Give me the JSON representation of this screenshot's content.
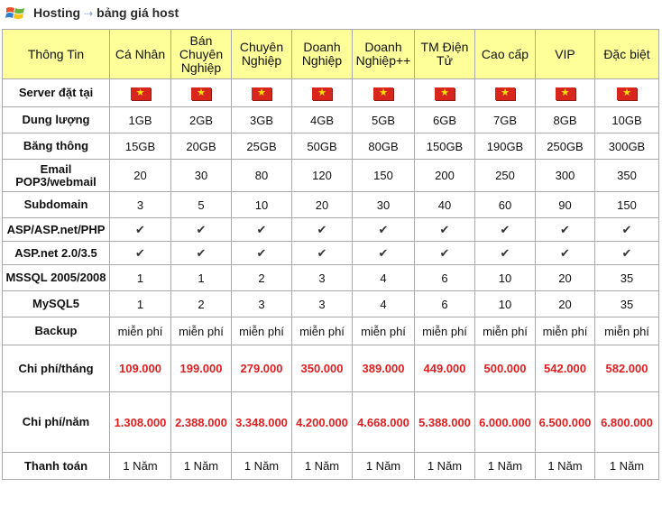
{
  "breadcrumb": {
    "root": "Hosting",
    "separator": "⇢",
    "current": "bảng giá host"
  },
  "colors": {
    "header_bg": "#ffff99",
    "price_red": "#e02020",
    "border": "#aaaaaa"
  },
  "table": {
    "corner_label": "Thông Tin",
    "plans": [
      "Cá Nhân",
      "Bán Chuyên Nghiệp",
      "Chuyên Nghiệp",
      "Doanh Nghiệp",
      "Doanh Nghiệp++",
      "TM Điện Tử",
      "Cao cấp",
      "VIP",
      "Đặc biệt"
    ],
    "rows": [
      {
        "label": "Server đặt tại",
        "type": "flag",
        "cells": [
          "vn-flag",
          "vn-flag",
          "vn-flag",
          "vn-flag",
          "vn-flag",
          "vn-flag",
          "vn-flag",
          "vn-flag",
          "vn-flag"
        ]
      },
      {
        "label": "Dung lượng",
        "type": "text",
        "cells": [
          "1GB",
          "2GB",
          "3GB",
          "4GB",
          "5GB",
          "6GB",
          "7GB",
          "8GB",
          "10GB"
        ]
      },
      {
        "label": "Băng thông",
        "type": "text",
        "cells": [
          "15GB",
          "20GB",
          "25GB",
          "50GB",
          "80GB",
          "150GB",
          "190GB",
          "250GB",
          "300GB"
        ]
      },
      {
        "label": "Email POP3/webmail",
        "type": "text",
        "cells": [
          "20",
          "30",
          "80",
          "120",
          "150",
          "200",
          "250",
          "300",
          "350"
        ]
      },
      {
        "label": "Subdomain",
        "type": "text",
        "cells": [
          "3",
          "5",
          "10",
          "20",
          "30",
          "40",
          "60",
          "90",
          "150"
        ]
      },
      {
        "label": "ASP/ASP.net/PHP",
        "type": "check",
        "cells": [
          "✔",
          "✔",
          "✔",
          "✔",
          "✔",
          "✔",
          "✔",
          "✔",
          "✔"
        ]
      },
      {
        "label": "ASP.net 2.0/3.5",
        "type": "check",
        "cells": [
          "✔",
          "✔",
          "✔",
          "✔",
          "✔",
          "✔",
          "✔",
          "✔",
          "✔"
        ]
      },
      {
        "label": "MSSQL 2005/2008",
        "type": "text",
        "cells": [
          "1",
          "1",
          "2",
          "3",
          "4",
          "6",
          "10",
          "20",
          "35"
        ]
      },
      {
        "label": "MySQL5",
        "type": "text",
        "cells": [
          "1",
          "2",
          "3",
          "3",
          "4",
          "6",
          "10",
          "20",
          "35"
        ]
      },
      {
        "label": "Backup",
        "type": "text",
        "cells": [
          "miễn phí",
          "miễn phí",
          "miễn phí",
          "miễn phí",
          "miễn phí",
          "miễn phí",
          "miễn phí",
          "miễn phí",
          "miễn phí"
        ]
      },
      {
        "label": "Chi phí/tháng",
        "type": "price",
        "cells": [
          "109.000",
          "199.000",
          "279.000",
          "350.000",
          "389.000",
          "449.000",
          "500.000",
          "542.000",
          "582.000"
        ]
      },
      {
        "label": "Chi phí/năm",
        "type": "price",
        "cells": [
          "1.308.000",
          "2.388.000",
          "3.348.000",
          "4.200.000",
          "4.668.000",
          "5.388.000",
          "6.000.000",
          "6.500.000",
          "6.800.000"
        ]
      },
      {
        "label": "Thanh toán",
        "type": "text",
        "cells": [
          "1 Năm",
          "1 Năm",
          "1 Năm",
          "1 Năm",
          "1 Năm",
          "1 Năm",
          "1 Năm",
          "1 Năm",
          "1 Năm"
        ]
      }
    ]
  }
}
